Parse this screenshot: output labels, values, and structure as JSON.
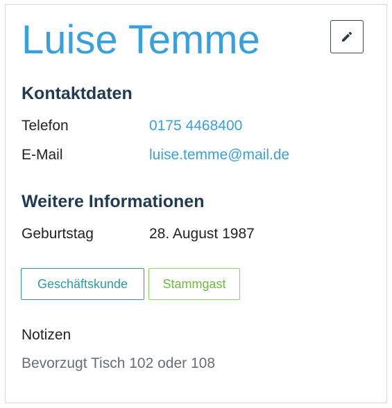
{
  "contact": {
    "name": "Luise Temme"
  },
  "actions": {
    "edit_icon": "pencil-icon"
  },
  "sections": {
    "contact_title": "Kontaktdaten",
    "more_title": "Weitere Informationen"
  },
  "fields": {
    "phone_label": "Telefon",
    "phone_value": "0175 4468400",
    "email_label": "E-Mail",
    "email_value": "luise.temme@mail.de",
    "birthday_label": "Geburtstag",
    "birthday_value": "28. August 1987"
  },
  "tags": [
    {
      "label": "Geschäftskunde",
      "color": "#2a9d9c"
    },
    {
      "label": "Stammgast",
      "color": "#8fcf5c"
    }
  ],
  "notes": {
    "label": "Notizen",
    "text": "Bevorzugt Tisch 102 oder 108"
  },
  "colors": {
    "accent": "#3aa0dc",
    "heading": "#1f3a52"
  }
}
